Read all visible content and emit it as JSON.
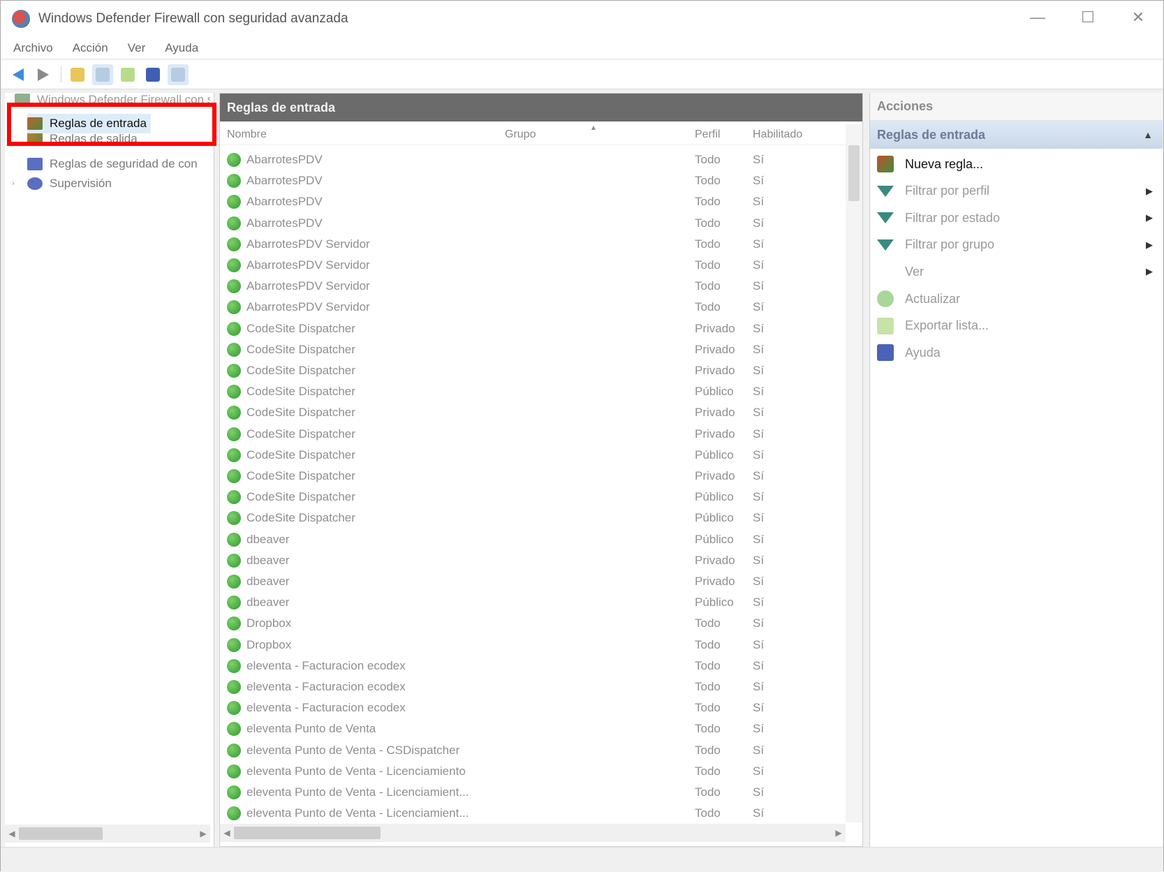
{
  "window": {
    "title": "Windows Defender Firewall con seguridad avanzada",
    "controls": {
      "minimize": "—",
      "maximize": "☐",
      "close": "✕"
    }
  },
  "menu": [
    "Archivo",
    "Acción",
    "Ver",
    "Ayuda"
  ],
  "toolbar": {
    "icons": [
      "back-arrow-icon",
      "forward-arrow-icon",
      "folder-icon",
      "console-tree-icon",
      "export-icon",
      "help-book-icon",
      "panel-icon"
    ]
  },
  "tree": {
    "root": "Windows Defender Firewall con seguridad avanzada",
    "items": [
      {
        "label": "Reglas de entrada",
        "selected": true
      },
      {
        "label": "Reglas de salida"
      },
      {
        "label": "Reglas de seguridad de con"
      },
      {
        "label": "Supervisión"
      }
    ]
  },
  "center": {
    "header": "Reglas de entrada",
    "columns": {
      "name": "Nombre",
      "group": "Grupo",
      "profile": "Perfil",
      "enabled": "Habilitado"
    },
    "rows": [
      {
        "name": "AbarrotesPDV",
        "profile": "Todo",
        "enabled": "Sí"
      },
      {
        "name": "AbarrotesPDV",
        "profile": "Todo",
        "enabled": "Sí"
      },
      {
        "name": "AbarrotesPDV",
        "profile": "Todo",
        "enabled": "Sí"
      },
      {
        "name": "AbarrotesPDV",
        "profile": "Todo",
        "enabled": "Sí"
      },
      {
        "name": "AbarrotesPDV Servidor",
        "profile": "Todo",
        "enabled": "Sí"
      },
      {
        "name": "AbarrotesPDV Servidor",
        "profile": "Todo",
        "enabled": "Sí"
      },
      {
        "name": "AbarrotesPDV Servidor",
        "profile": "Todo",
        "enabled": "Sí"
      },
      {
        "name": "AbarrotesPDV Servidor",
        "profile": "Todo",
        "enabled": "Sí"
      },
      {
        "name": "CodeSite Dispatcher",
        "profile": "Privado",
        "enabled": "Sí"
      },
      {
        "name": "CodeSite Dispatcher",
        "profile": "Privado",
        "enabled": "Sí"
      },
      {
        "name": "CodeSite Dispatcher",
        "profile": "Privado",
        "enabled": "Sí"
      },
      {
        "name": "CodeSite Dispatcher",
        "profile": "Público",
        "enabled": "Sí"
      },
      {
        "name": "CodeSite Dispatcher",
        "profile": "Privado",
        "enabled": "Sí"
      },
      {
        "name": "CodeSite Dispatcher",
        "profile": "Privado",
        "enabled": "Sí"
      },
      {
        "name": "CodeSite Dispatcher",
        "profile": "Público",
        "enabled": "Sí"
      },
      {
        "name": "CodeSite Dispatcher",
        "profile": "Privado",
        "enabled": "Sí"
      },
      {
        "name": "CodeSite Dispatcher",
        "profile": "Público",
        "enabled": "Sí"
      },
      {
        "name": "CodeSite Dispatcher",
        "profile": "Público",
        "enabled": "Sí"
      },
      {
        "name": "dbeaver",
        "profile": "Público",
        "enabled": "Sí"
      },
      {
        "name": "dbeaver",
        "profile": "Privado",
        "enabled": "Sí"
      },
      {
        "name": "dbeaver",
        "profile": "Privado",
        "enabled": "Sí"
      },
      {
        "name": "dbeaver",
        "profile": "Público",
        "enabled": "Sí"
      },
      {
        "name": "Dropbox",
        "profile": "Todo",
        "enabled": "Sí"
      },
      {
        "name": "Dropbox",
        "profile": "Todo",
        "enabled": "Sí"
      },
      {
        "name": "eleventa - Facturacion ecodex",
        "profile": "Todo",
        "enabled": "Sí"
      },
      {
        "name": "eleventa - Facturacion ecodex",
        "profile": "Todo",
        "enabled": "Sí"
      },
      {
        "name": "eleventa - Facturacion ecodex",
        "profile": "Todo",
        "enabled": "Sí"
      },
      {
        "name": "eleventa Punto de Venta",
        "profile": "Todo",
        "enabled": "Sí"
      },
      {
        "name": "eleventa Punto de Venta - CSDispatcher",
        "profile": "Todo",
        "enabled": "Sí"
      },
      {
        "name": "eleventa Punto de Venta - Licenciamiento",
        "profile": "Todo",
        "enabled": "Sí"
      },
      {
        "name": "eleventa Punto de Venta - Licenciamient...",
        "profile": "Todo",
        "enabled": "Sí"
      },
      {
        "name": "eleventa Punto de Venta - Licenciamient...",
        "profile": "Todo",
        "enabled": "Sí"
      }
    ]
  },
  "actions": {
    "title": "Acciones",
    "section": "Reglas de entrada",
    "items": [
      {
        "label": "Nueva regla...",
        "icon": "new-rule-icon",
        "primary": true,
        "submenu": false
      },
      {
        "label": "Filtrar por perfil",
        "icon": "filter-icon",
        "submenu": true
      },
      {
        "label": "Filtrar por estado",
        "icon": "filter-icon",
        "submenu": true
      },
      {
        "label": "Filtrar por grupo",
        "icon": "filter-icon",
        "submenu": true
      },
      {
        "label": "Ver",
        "icon": "",
        "submenu": true
      },
      {
        "label": "Actualizar",
        "icon": "refresh-icon",
        "submenu": false
      },
      {
        "label": "Exportar lista...",
        "icon": "export-icon",
        "submenu": false
      },
      {
        "label": "Ayuda",
        "icon": "help-book-icon",
        "submenu": false
      }
    ]
  },
  "colors": {
    "highlight_box": "#ff0000",
    "center_header_bg": "#6b6b6b",
    "action_section_bg": "#c9d8ea",
    "rule_enabled": "#2e9a2e"
  }
}
